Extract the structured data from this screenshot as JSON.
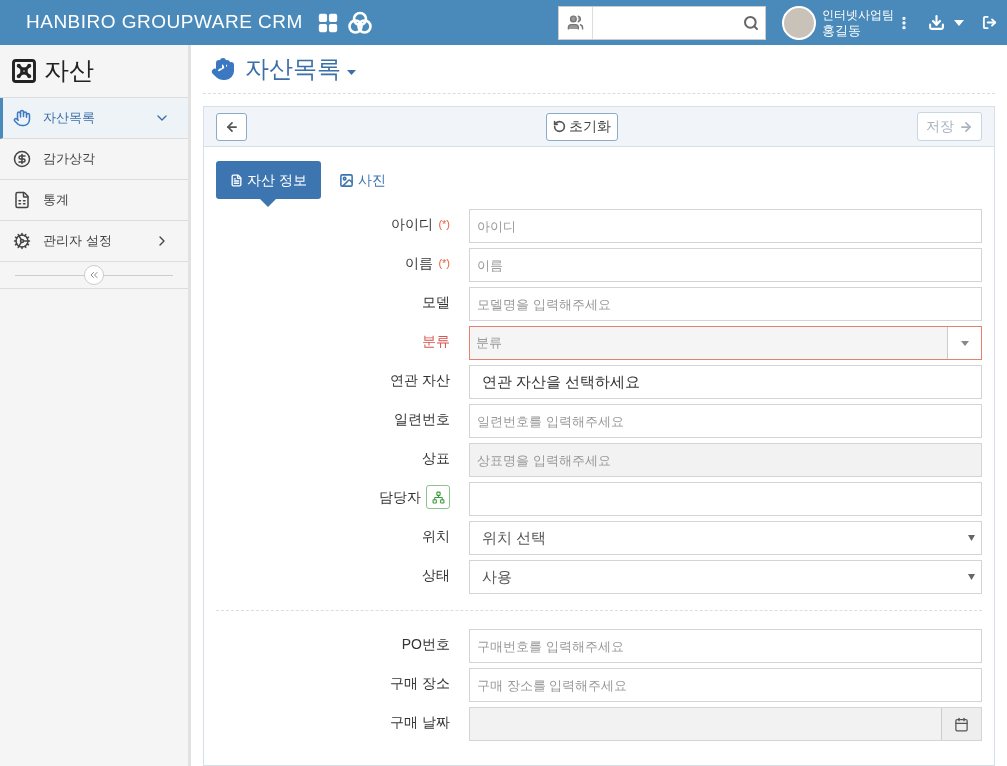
{
  "header": {
    "title": "HANBIRO GROUPWARE CRM",
    "user": {
      "team": "인터넷사업팀",
      "name": "홍길동"
    }
  },
  "sidebar": {
    "title": "자산",
    "items": [
      {
        "label": "자산목록",
        "selected": true,
        "has_children": true,
        "expanded": true
      },
      {
        "label": "감가상각",
        "selected": false,
        "has_children": false
      },
      {
        "label": "통계",
        "selected": false,
        "has_children": false
      },
      {
        "label": "관리자 설정",
        "selected": false,
        "has_children": true,
        "expanded": false
      }
    ]
  },
  "page": {
    "title": "자산목록"
  },
  "toolbar": {
    "reset": "초기화",
    "save": "저장",
    "save_disabled": true
  },
  "tabs": [
    {
      "label": "자산 정보",
      "selected": true
    },
    {
      "label": "사진",
      "selected": false
    }
  ],
  "sections": [
    [
      {
        "label": "아이디",
        "required_mark": "(*)",
        "kind": "text",
        "placeholder": "아이디",
        "disabled": false,
        "error": false
      },
      {
        "label": "이름",
        "required_mark": "(*)",
        "kind": "text",
        "placeholder": "이름",
        "disabled": false,
        "error": false
      },
      {
        "label": "모델",
        "kind": "text",
        "placeholder": "모델명을 입력해주세요",
        "disabled": false,
        "error": false
      },
      {
        "label": "분류",
        "kind": "combo",
        "placeholder": "분류",
        "disabled": false,
        "error": true
      },
      {
        "label": "연관 자산",
        "kind": "text",
        "value": "연관 자산을 선택하세요",
        "disabled": false,
        "error": false
      },
      {
        "label": "일련번호",
        "kind": "text",
        "placeholder": "일련번호를 입력해주세요",
        "disabled": false,
        "error": false
      },
      {
        "label": "상표",
        "kind": "text",
        "placeholder": "상표명을 입력해주세요",
        "disabled": true,
        "error": false
      },
      {
        "label": "담당자",
        "kind": "person",
        "disabled": false,
        "error": false
      },
      {
        "label": "위치",
        "kind": "select",
        "value": "위치 선택",
        "disabled": false,
        "error": false
      },
      {
        "label": "상태",
        "kind": "select",
        "value": "사용",
        "disabled": false,
        "error": false
      }
    ],
    [
      {
        "label": "PO번호",
        "kind": "text",
        "placeholder": "구매번호를 입력해주세요",
        "disabled": false,
        "error": false
      },
      {
        "label": "구매 장소",
        "kind": "text",
        "placeholder": "구매 장소를 입력해주세요",
        "disabled": false,
        "error": false
      },
      {
        "label": "구매 날짜",
        "kind": "date",
        "disabled": true,
        "error": false
      }
    ]
  ]
}
